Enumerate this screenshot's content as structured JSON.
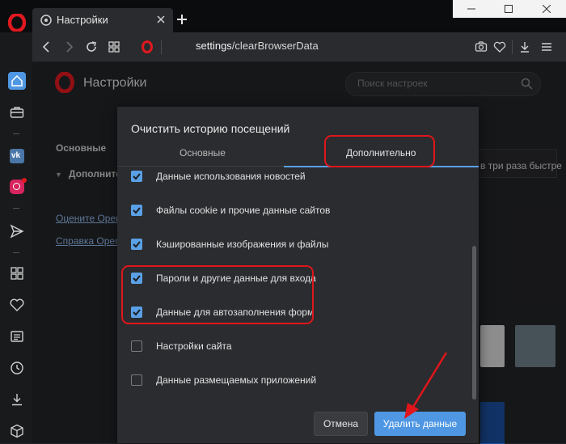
{
  "browser": {
    "tab_title": "Настройки",
    "url_prefix": "settings",
    "url_path": "/clearBrowserData"
  },
  "page": {
    "title": "Настройки",
    "search_placeholder": "Поиск настроек",
    "nav": {
      "basic": "Основные",
      "advanced": "Дополнительно",
      "link_rate": "Оцените Opera",
      "link_help": "Справка Opera"
    },
    "bg_text": "в три раза быстре"
  },
  "dialog": {
    "title": "Очистить историю посещений",
    "tabs": [
      {
        "label": "Основные",
        "active": false
      },
      {
        "label": "Дополнительно",
        "active": true
      }
    ],
    "options": [
      {
        "label": "Данные использования новостей",
        "checked": true
      },
      {
        "label": "Файлы cookie и прочие данные сайтов",
        "checked": true
      },
      {
        "label": "Кэшированные изображения и файлы",
        "checked": true
      },
      {
        "label": "Пароли и другие данные для входа",
        "checked": true
      },
      {
        "label": "Данные для автозаполнения форм",
        "checked": true
      },
      {
        "label": "Настройки сайта",
        "checked": false
      },
      {
        "label": "Данные размещаемых приложений",
        "checked": false
      }
    ],
    "cancel_label": "Отмена",
    "delete_label": "Удалить данные"
  },
  "colors": {
    "accent": "#5aa0e6",
    "annotation": "#e0161c",
    "brand": "#e0191f"
  },
  "icons": {
    "sidebar": [
      "home-icon",
      "briefcase-icon",
      "vk-icon",
      "instagram-icon",
      "send-icon",
      "apps-grid-icon",
      "heart-icon",
      "news-icon",
      "history-icon",
      "download-icon",
      "cube-icon"
    ],
    "addressbar": [
      "back-icon",
      "forward-icon",
      "reload-icon",
      "tabs-grid-icon",
      "opera-icon",
      "camera-icon",
      "heart-icon",
      "download-icon",
      "menu-icon"
    ]
  }
}
